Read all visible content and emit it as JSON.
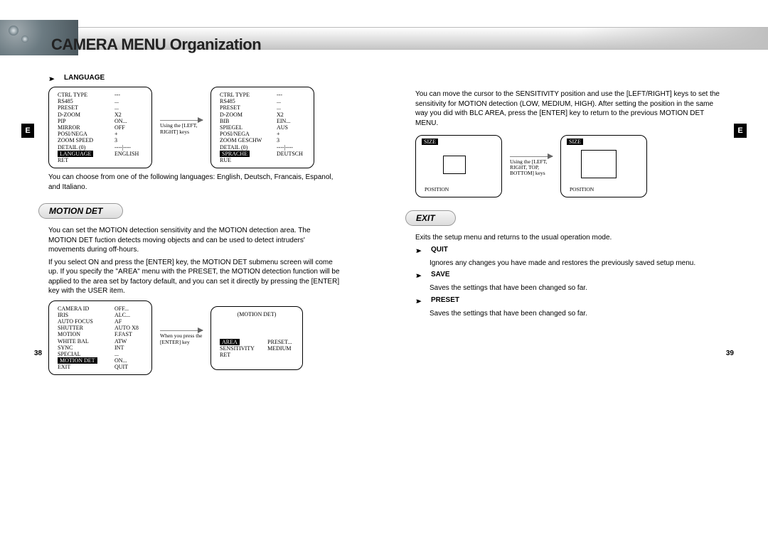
{
  "title": "CAMERA MENU Organization",
  "tab_letter": "E",
  "page_numbers": {
    "left": "38",
    "right": "39"
  },
  "left": {
    "language": {
      "label": "LANGUAGE",
      "desc": "You can choose from one of the following languages: English, Deutsch, Francais, Espanol, and Italiano.",
      "arrow_caption": "Using the [LEFT, RIGHT] keys",
      "menu_en": [
        [
          "CTRL TYPE",
          "---"
        ],
        [
          "RS485",
          "..."
        ],
        [
          "PRESET",
          "..."
        ],
        [
          "D-ZOOM",
          "X2"
        ],
        [
          "PIP",
          "ON..."
        ],
        [
          "MIRROR",
          "OFF"
        ],
        [
          "POSI/NEGA",
          "+"
        ],
        [
          "ZOOM SPEED",
          "3"
        ],
        [
          "DETAIL (0)",
          "----|----"
        ],
        [
          "LANGUAGE",
          "ENGLISH"
        ],
        [
          "RET",
          ""
        ]
      ],
      "menu_de": [
        [
          "CTRL TYPE",
          "---"
        ],
        [
          "RS485",
          "..."
        ],
        [
          "PRESET",
          "..."
        ],
        [
          "D-ZOOM",
          "X2"
        ],
        [
          "BIB",
          "EIN..."
        ],
        [
          "SPIEGEL",
          "AUS"
        ],
        [
          "POSI/NEGA",
          "+"
        ],
        [
          "ZOOM GESCHW",
          "3"
        ],
        [
          "DETAIL (0)",
          "----|----"
        ],
        [
          "SPRACHE",
          "DEUTSCH"
        ],
        [
          "RUE",
          ""
        ]
      ]
    },
    "motion_det": {
      "header": "MOTION DET",
      "desc1": "You can set the MOTION detection sensitivity and the MOTION detection area. The MOTION DET fuction detects moving objects and can be used to detect intruders' movements during off-hours.",
      "desc2": "If you select ON and press the [ENTER] key, the MOTION DET submenu screen will come up. If you specify the \"AREA\" menu with the PRESET, the MOTION detection function will be applied to the area set by factory default, and you can set it directly by pressing the [ENTER] key with the USER item.",
      "arrow_caption": "When you press the [ENTER] key",
      "menu_main": [
        [
          "CAMERA ID",
          "OFF..."
        ],
        [
          "IRIS",
          "ALC..."
        ],
        [
          "AUTO FOCUS",
          "AF"
        ],
        [
          "SHUTTER",
          "AUTO X8"
        ],
        [
          "MOTION",
          "F.FAST"
        ],
        [
          "WHITE BAL",
          "ATW"
        ],
        [
          "SYNC",
          "INT"
        ],
        [
          "SPECIAL",
          "..."
        ],
        [
          "MOTION DET",
          "ON..."
        ],
        [
          "EXIT",
          "QUIT"
        ]
      ],
      "menu_sub_title": "(MOTION DET)",
      "menu_sub": [
        [
          "AREA",
          "PRESET..."
        ],
        [
          "SENSITIVITY",
          "MEDIUM"
        ],
        [
          "RET",
          ""
        ]
      ]
    }
  },
  "right": {
    "intro": "You can move the cursor to the SENSITIVITY position and use the [LEFT/RIGHT] keys to set the sensitivity for MOTION detection (LOW, MEDIUM, HIGH). After setting the position in the same way you did with BLC AREA, press the [ENTER] key to return to the previous MOTION DET MENU.",
    "size_label": "SIZE",
    "position_label": "POSITION",
    "arrow_caption": "Using the [LEFT, RIGHT, TOP, BOTTOM] keys",
    "exit": {
      "header": "EXIT",
      "desc": "Exits the setup menu and returns to the usual operation mode.",
      "quit_label": "QUIT",
      "quit_desc": "Ignores any changes you have made and restores the previously saved setup menu.",
      "save_label": "SAVE",
      "save_desc": "Saves the settings that have been changed so far.",
      "preset_label": "PRESET",
      "preset_desc": "Saves the settings that have been changed so far."
    }
  }
}
